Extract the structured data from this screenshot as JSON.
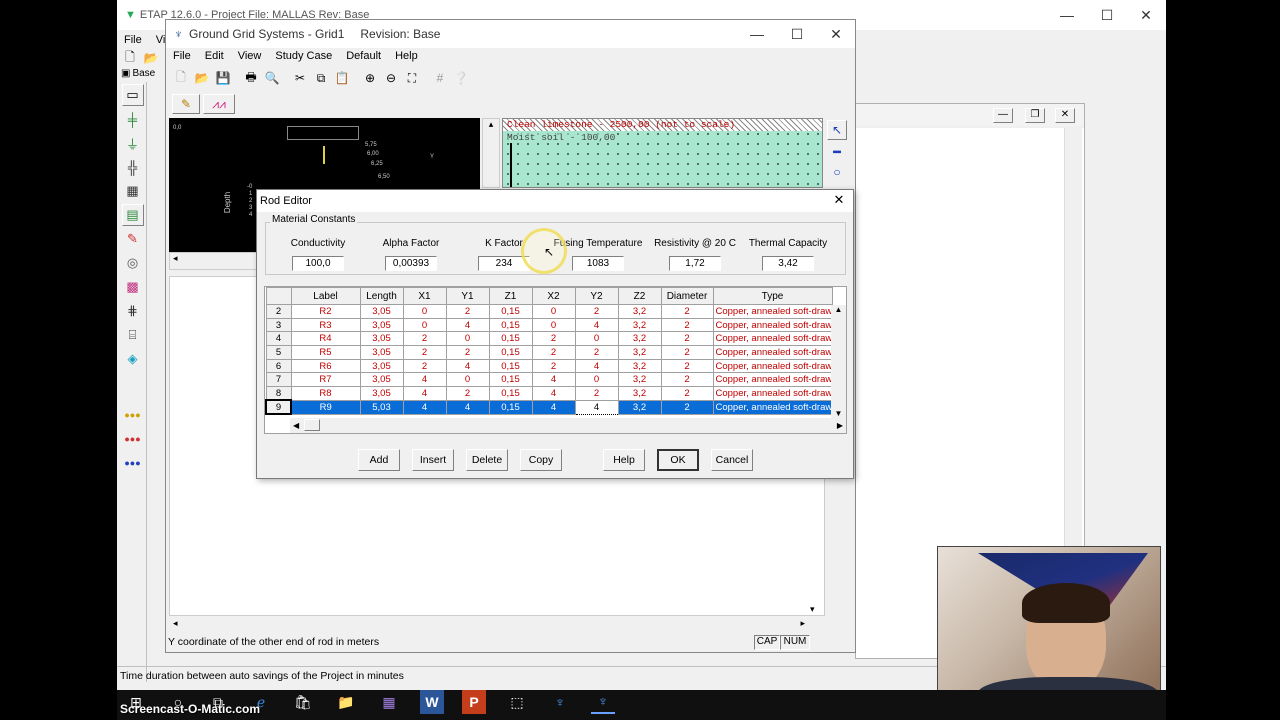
{
  "etap": {
    "title": "ETAP 12.6.0 - Project File: MALLAS Rev: Base",
    "menu": [
      "File",
      "View"
    ],
    "base_label": "Base",
    "status": "Time duration between auto savings of the Project in minutes"
  },
  "ggs": {
    "title": "Ground Grid Systems - Grid1",
    "revision": "Revision: Base",
    "menu": [
      "File",
      "Edit",
      "View",
      "Study Case",
      "Default",
      "Help"
    ],
    "soil_top": "Clean limestone - 2500,00    (not to scale)",
    "soil_layer": "Moist soil - 100,00",
    "depth_label": "Depth",
    "status": "Y coordinate of the other end of rod in meters",
    "cap": "CAP",
    "num": "NUM",
    "plot_values": [
      "0,0",
      "5,75",
      "6,00",
      "6,25",
      "6,50",
      "Y",
      "-0",
      "1",
      "2",
      "3",
      "4"
    ]
  },
  "rod_editor": {
    "title": "Rod Editor",
    "group_label": "Material Constants",
    "constants": [
      {
        "label": "Conductivity",
        "value": "100,0"
      },
      {
        "label": "Alpha Factor",
        "value": "0,00393"
      },
      {
        "label": "K Factor",
        "value": "234"
      },
      {
        "label": "Fusing Temperature",
        "value": "1083"
      },
      {
        "label": "Resistivity @ 20 C",
        "value": "1,72"
      },
      {
        "label": "Thermal Capacity",
        "value": "3,42"
      }
    ],
    "columns": [
      "",
      "Label",
      "Length",
      "X1",
      "Y1",
      "Z1",
      "X2",
      "Y2",
      "Z2",
      "Diameter",
      "Type"
    ],
    "rows": [
      [
        "2",
        "R2",
        "3,05",
        "0",
        "2",
        "0,15",
        "0",
        "2",
        "3,2",
        "2",
        "Copper, annealed soft-drawn"
      ],
      [
        "3",
        "R3",
        "3,05",
        "0",
        "4",
        "0,15",
        "0",
        "4",
        "3,2",
        "2",
        "Copper, annealed soft-drawn"
      ],
      [
        "4",
        "R4",
        "3,05",
        "2",
        "0",
        "0,15",
        "2",
        "0",
        "3,2",
        "2",
        "Copper, annealed soft-drawn"
      ],
      [
        "5",
        "R5",
        "3,05",
        "2",
        "2",
        "0,15",
        "2",
        "2",
        "3,2",
        "2",
        "Copper, annealed soft-drawn"
      ],
      [
        "6",
        "R6",
        "3,05",
        "2",
        "4",
        "0,15",
        "2",
        "4",
        "3,2",
        "2",
        "Copper, annealed soft-drawn"
      ],
      [
        "7",
        "R7",
        "3,05",
        "4",
        "0",
        "0,15",
        "4",
        "0",
        "3,2",
        "2",
        "Copper, annealed soft-drawn"
      ],
      [
        "8",
        "R8",
        "3,05",
        "4",
        "2",
        "0,15",
        "4",
        "2",
        "3,2",
        "2",
        "Copper, annealed soft-drawn"
      ],
      [
        "9",
        "R9",
        "5,03",
        "4",
        "4",
        "0,15",
        "4",
        "4",
        "3,2",
        "2",
        "Copper, annealed soft-drawn"
      ]
    ],
    "buttons": {
      "add": "Add",
      "insert": "Insert",
      "delete": "Delete",
      "copy": "Copy",
      "help": "Help",
      "ok": "OK",
      "cancel": "Cancel"
    }
  },
  "watermark": "Screencast-O-Matic.com",
  "colors": {
    "selection": "#0a6cd6",
    "data_text": "#c00000",
    "soil_green": "#a8e6cf",
    "taskbar": "#101010"
  }
}
